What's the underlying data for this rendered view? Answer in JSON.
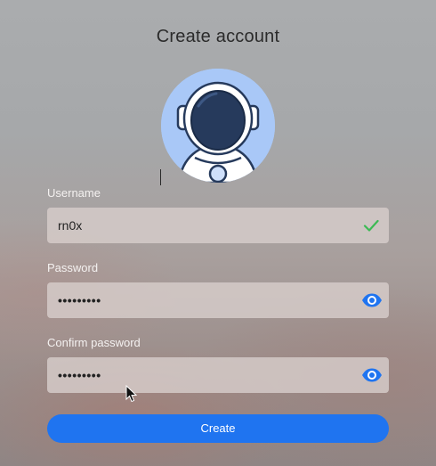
{
  "header": {
    "title": "Create account"
  },
  "form": {
    "username": {
      "label": "Username",
      "value": "rn0x",
      "status_icon": "check-icon"
    },
    "password": {
      "label": "Password",
      "value": "•••••••••",
      "toggle_icon": "eye-icon"
    },
    "confirm_password": {
      "label": "Confirm password",
      "value": "•••••••••",
      "toggle_icon": "eye-icon"
    },
    "submit_label": "Create"
  },
  "colors": {
    "accent": "#1f74f0",
    "valid": "#3cba54",
    "avatar_bg": "#a9c8f7",
    "helmet_visor": "#263a5c"
  }
}
